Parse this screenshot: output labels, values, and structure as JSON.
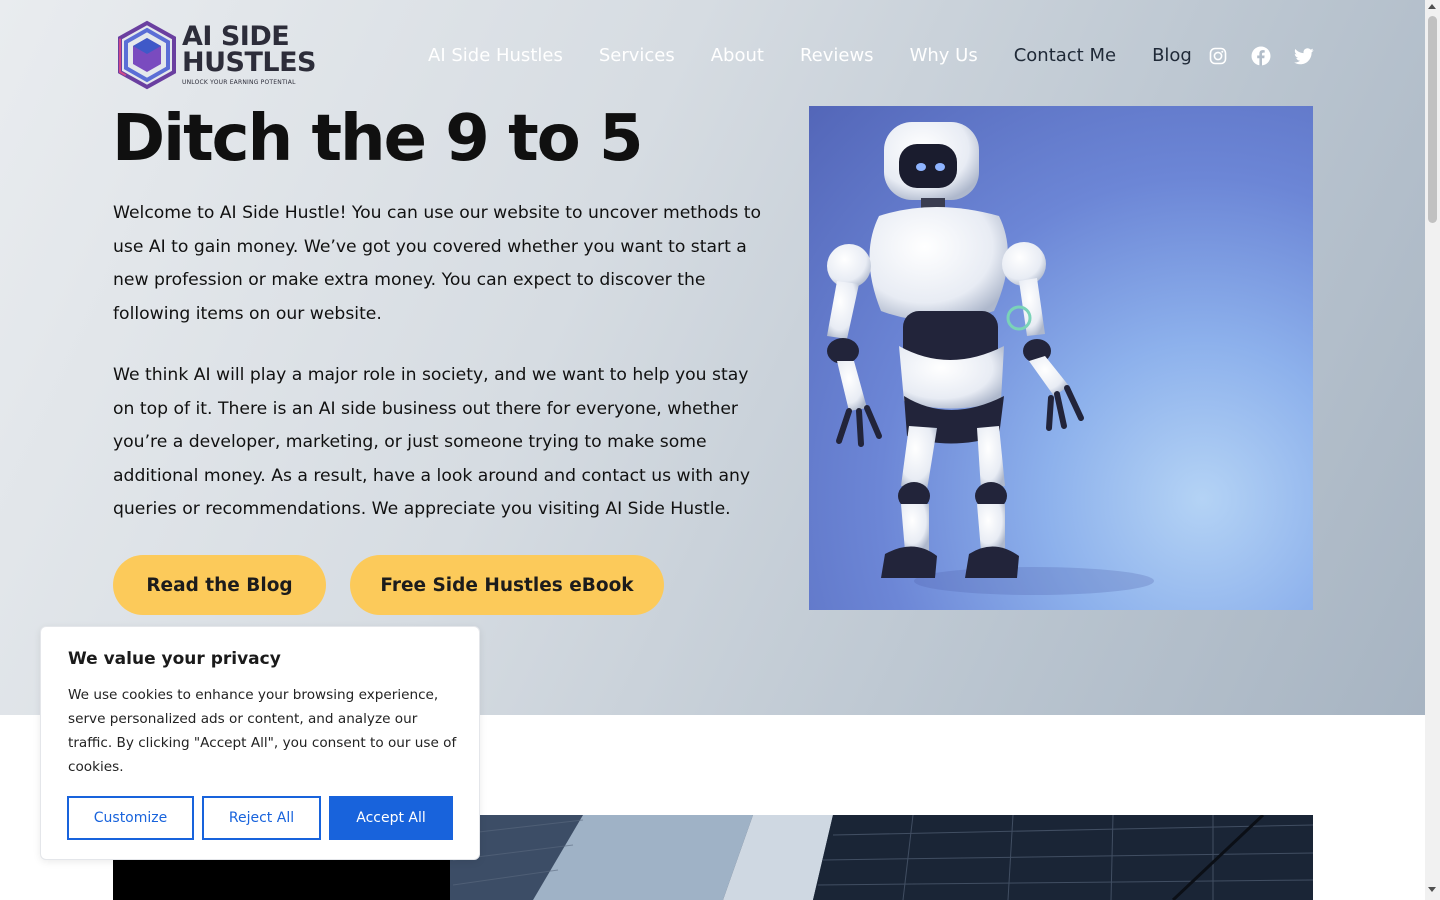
{
  "brand": {
    "name_line1": "AI SIDE",
    "name_line2": "HUSTLES",
    "tagline": "UNLOCK YOUR EARNING POTENTIAL",
    "logo_colors": {
      "outer": "#5b6ed6",
      "inner": "#7a3f9e",
      "accent": "#d04a8a"
    }
  },
  "nav": {
    "items": [
      {
        "label": "AI Side Hustles"
      },
      {
        "label": "Services"
      },
      {
        "label": "About"
      },
      {
        "label": "Reviews"
      },
      {
        "label": "Why Us"
      },
      {
        "label": "Contact Me"
      },
      {
        "label": "Blog"
      }
    ],
    "socials": [
      "instagram-icon",
      "facebook-icon",
      "twitter-icon"
    ]
  },
  "hero": {
    "headline": "Ditch the 9 to 5",
    "paragraph1": "Welcome to AI Side Hustle! You can use our website to uncover methods to use AI to gain money. We’ve got you covered whether you want to start a new profession or make extra money. You can expect to discover the following items on our website.",
    "paragraph2": "We think AI will play a major role in society, and we want to help you stay on top of it. There is an AI side business out there for everyone, whether you’re a developer, marketing, or just someone trying to make some additional money. As a result, have a look around and contact us with any queries or recommendations. We appreciate you visiting AI Side Hustle.",
    "button_blog": "Read the Blog",
    "button_ebook": "Free Side Hustles eBook",
    "button_color": "#fcca5a"
  },
  "cookie": {
    "title": "We value your privacy",
    "text": "We use cookies to enhance your browsing experience, serve personalized ads or content, and analyze our traffic. By clicking \"Accept All\", you consent to our use of cookies.",
    "customize": "Customize",
    "reject": "Reject All",
    "accept": "Accept All",
    "accent_color": "#1863dc"
  }
}
